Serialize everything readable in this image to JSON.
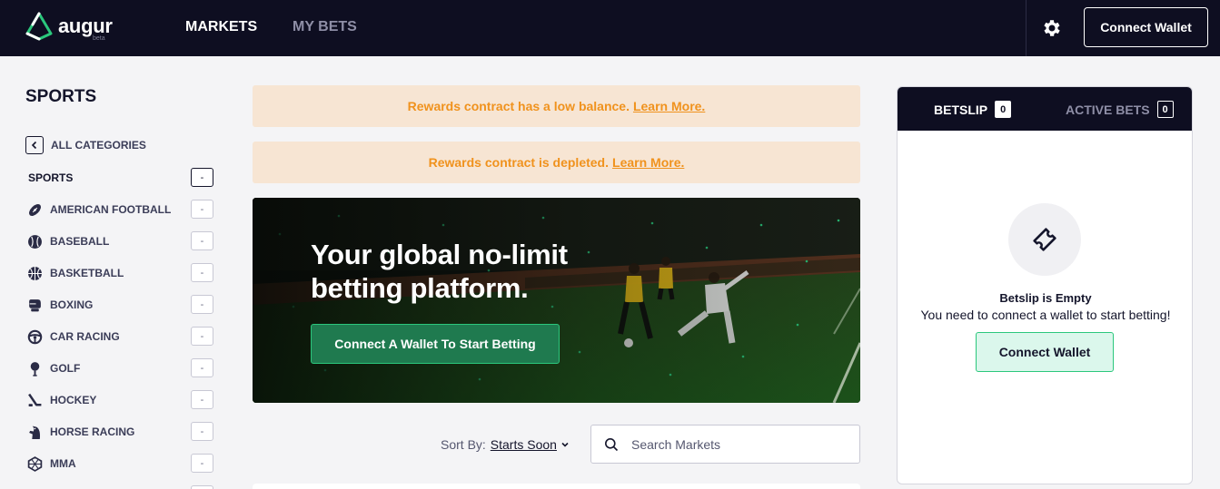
{
  "header": {
    "logo_text": "augur",
    "logo_badge": "beta",
    "nav": [
      {
        "label": "MARKETS",
        "active": true
      },
      {
        "label": "MY BETS",
        "active": false
      }
    ],
    "settings_icon": "gear-icon",
    "connect_wallet_label": "Connect Wallet"
  },
  "sidebar": {
    "title": "SPORTS",
    "back_label": "ALL CATEGORIES",
    "section": {
      "label": "SPORTS",
      "count": "-"
    },
    "categories": [
      {
        "label": "AMERICAN FOOTBALL",
        "icon": "american-football-icon",
        "count": "-"
      },
      {
        "label": "BASEBALL",
        "icon": "baseball-icon",
        "count": "-"
      },
      {
        "label": "BASKETBALL",
        "icon": "basketball-icon",
        "count": "-"
      },
      {
        "label": "BOXING",
        "icon": "boxing-glove-icon",
        "count": "-"
      },
      {
        "label": "CAR RACING",
        "icon": "steering-wheel-icon",
        "count": "-"
      },
      {
        "label": "GOLF",
        "icon": "golf-icon",
        "count": "-"
      },
      {
        "label": "HOCKEY",
        "icon": "hockey-stick-icon",
        "count": "-"
      },
      {
        "label": "HORSE RACING",
        "icon": "horse-icon",
        "count": "-"
      },
      {
        "label": "MMA",
        "icon": "mma-icon",
        "count": "-"
      }
    ]
  },
  "notices": [
    {
      "text": "Rewards contract has a low balance.",
      "link": "Learn More."
    },
    {
      "text": "Rewards contract is depleted.",
      "link": "Learn More."
    }
  ],
  "hero": {
    "title": "Your global no-limit betting platform.",
    "cta_label": "Connect A Wallet To Start Betting"
  },
  "filters": {
    "sort_label": "Sort By:",
    "sort_value": "Starts Soon",
    "search_placeholder": "Search Markets"
  },
  "betslip": {
    "tabs": [
      {
        "label": "BETSLIP",
        "count": "0",
        "active": true
      },
      {
        "label": "ACTIVE BETS",
        "count": "0",
        "active": false
      }
    ],
    "empty_icon": "ticket-icon",
    "empty_title": "Betslip is Empty",
    "empty_message": "You need to connect a wallet to start betting!",
    "connect_label": "Connect Wallet"
  },
  "colors": {
    "nav_bg": "#0e0e21",
    "accent_green": "#2bc77c",
    "notice_bg": "#f7e5d3",
    "notice_text": "#f0921d"
  }
}
